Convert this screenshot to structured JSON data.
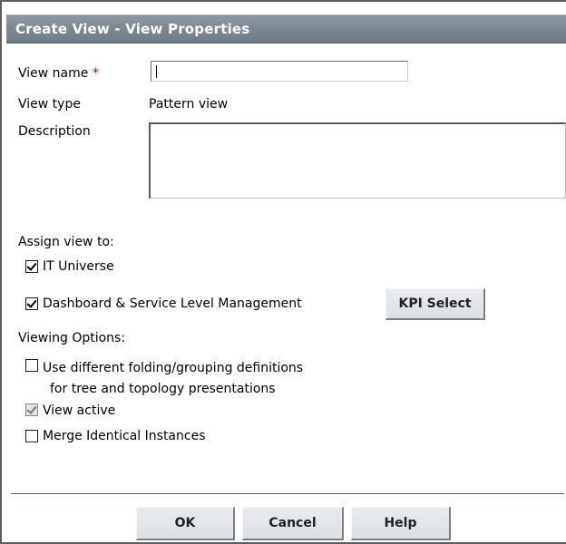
{
  "dialog": {
    "title": "Create View - View Properties"
  },
  "form": {
    "view_name_label": "View name",
    "required_marker": "*",
    "view_name_value": "",
    "view_type_label": "View type",
    "view_type_value": "Pattern view",
    "description_label": "Description",
    "description_value": ""
  },
  "assign": {
    "heading": "Assign view to:",
    "it_universe": {
      "label": "IT Universe",
      "checked": true
    },
    "dashboard": {
      "label": "Dashboard & Service Level Management",
      "checked": true
    },
    "kpi_select_label": "KPI Select"
  },
  "viewing_options": {
    "heading": "Viewing Options:",
    "folding": {
      "line1": "Use different folding/grouping definitions",
      "line2": "for tree and topology presentations",
      "checked": false
    },
    "view_active": {
      "label": "View active",
      "checked": true,
      "disabled": true
    },
    "merge": {
      "label": "Merge Identical Instances",
      "checked": false
    }
  },
  "footer": {
    "ok_label": "OK",
    "cancel_label": "Cancel",
    "help_label": "Help"
  }
}
